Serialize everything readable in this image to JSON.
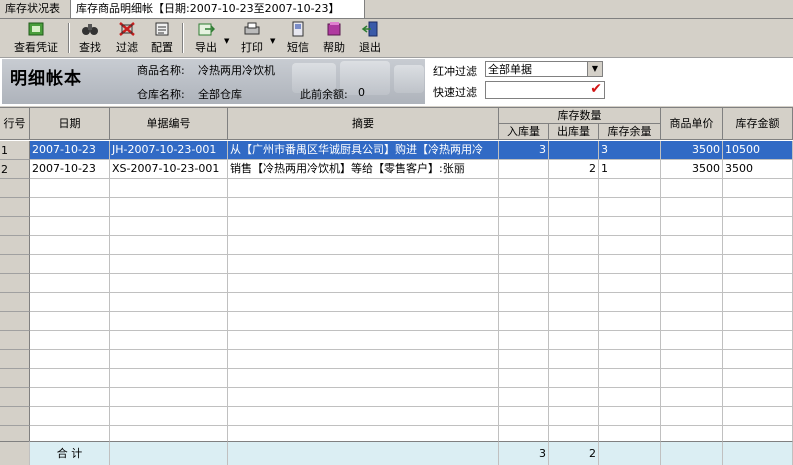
{
  "tabs": [
    {
      "label": "库存状况表"
    },
    {
      "label": "库存商品明细帐【日期:2007-10-23至2007-10-23】"
    }
  ],
  "toolbar": {
    "voucher": "查看凭证",
    "find": "查找",
    "filter": "过滤",
    "config": "配置",
    "export": "导出",
    "print": "打印",
    "sms": "短信",
    "help": "帮助",
    "exit": "退出"
  },
  "header": {
    "title": "明细帐本",
    "product_label": "商品名称:",
    "product_value": "冷热两用冷饮机",
    "warehouse_label": "仓库名称:",
    "warehouse_value": "全部仓库",
    "balance_label": "此前余额:",
    "balance_value": "0",
    "red_filter_label": "红冲过滤",
    "red_filter_value": "全部单据",
    "quick_filter_label": "快速过滤"
  },
  "table": {
    "col_row": "行号",
    "col_date": "日期",
    "col_docno": "单据编号",
    "col_summary": "摘要",
    "col_stock_group": "库存数量",
    "col_in": "入库量",
    "col_out": "出库量",
    "col_remain": "库存余量",
    "col_price": "商品单价",
    "col_amount": "库存金额",
    "rows": [
      {
        "row": "1",
        "date": "2007-10-23",
        "docno": "JH-2007-10-23-001",
        "summary": "从【广州市番禺区华诚厨具公司】购进【冷热两用冷",
        "in": "3",
        "out": "",
        "remain": "3",
        "price": "3500",
        "amount": "10500"
      },
      {
        "row": "2",
        "date": "2007-10-23",
        "docno": "XS-2007-10-23-001",
        "summary": "销售【冷热两用冷饮机】等给【零售客户】:张丽",
        "in": "",
        "out": "2",
        "remain": "1",
        "price": "3500",
        "amount": "3500"
      }
    ],
    "footer": {
      "label": "合 计",
      "in_total": "3",
      "out_total": "2"
    }
  }
}
